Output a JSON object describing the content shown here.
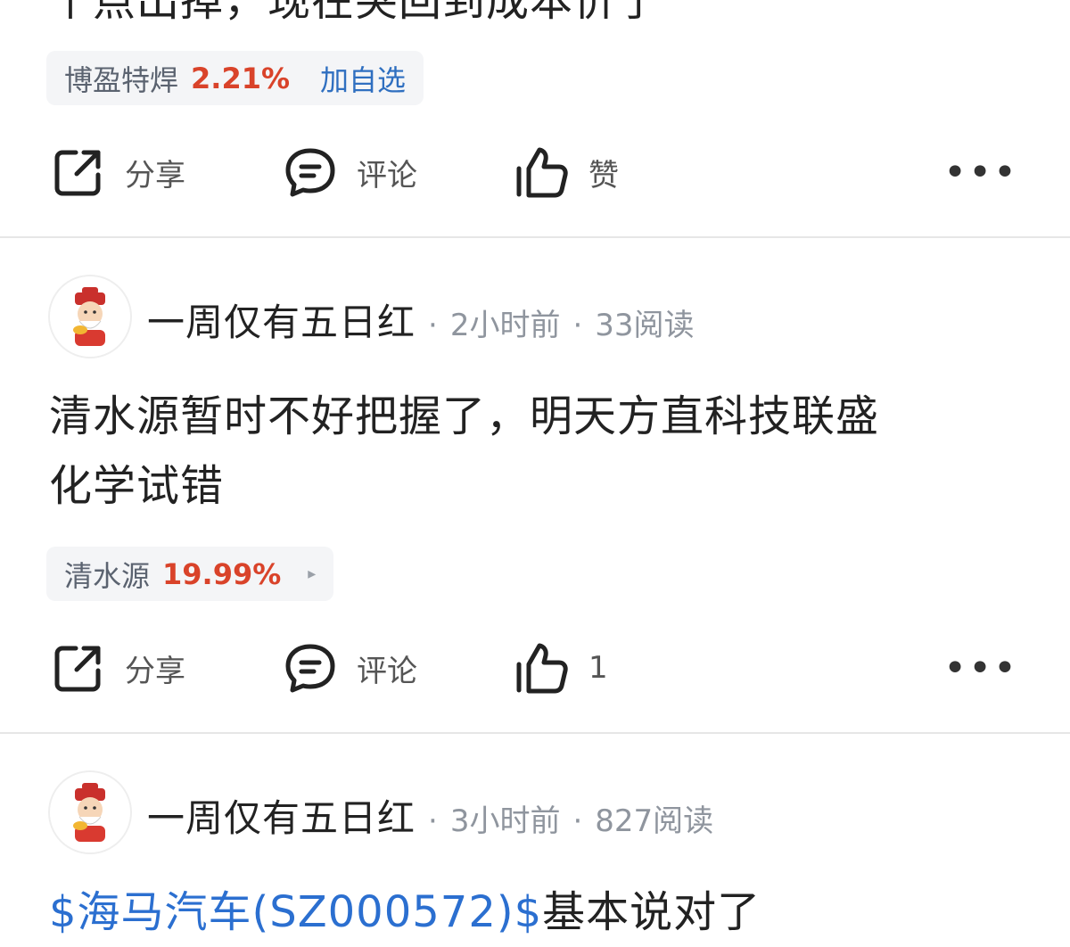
{
  "post0": {
    "text_cut": "个点出掉，现在突回到成本价了",
    "chip": {
      "name": "博盈特焊",
      "pct": "2.21%",
      "add_label": "加自选"
    },
    "actions": {
      "share": "分享",
      "comment": "评论",
      "like": "赞"
    }
  },
  "post1": {
    "author": "一周仅有五日红",
    "time": "2小时前",
    "reads": "33阅读",
    "sep": "·",
    "text_line1": "清水源暂时不好把握了，明天方直科技联盛",
    "text_line2": "化学试错",
    "chip": {
      "name": "清水源",
      "pct": "19.99%",
      "arrow": "▸"
    },
    "actions": {
      "share": "分享",
      "comment": "评论",
      "like_count": "1"
    }
  },
  "post2": {
    "author": "一周仅有五日红",
    "time": "3小时前",
    "reads": "827阅读",
    "sep": "·",
    "stock_link": "$海马汽车(SZ000572)$",
    "text_rest": "基本说对了"
  },
  "more_label": "•••",
  "colors": {
    "up": "#d9432a",
    "link": "#2b6fd0",
    "chip_bg": "#f4f5f7",
    "meta": "#8f959e"
  },
  "icons": [
    "share-icon",
    "comment-icon",
    "thumbs-up-icon",
    "more-icon",
    "avatar-icon"
  ]
}
